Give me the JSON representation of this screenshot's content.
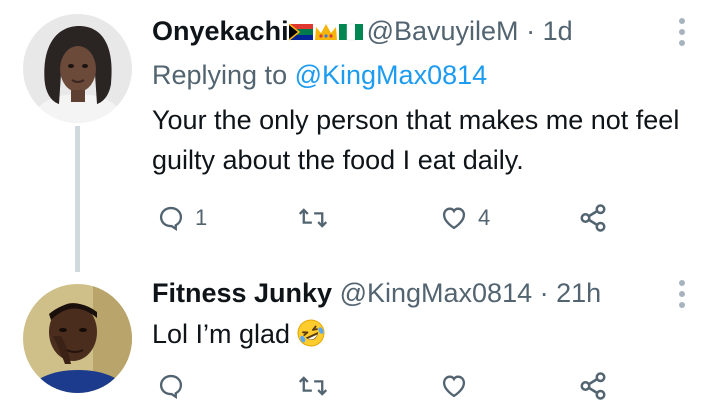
{
  "tweets": [
    {
      "name": "Onyekachi",
      "flags": [
        "south-africa-flag",
        "crown",
        "nigeria-flag"
      ],
      "handle": "@BavuyileM",
      "separator": "·",
      "time": "1d",
      "replying_label": "Replying to",
      "replying_to": "@KingMax0814",
      "text": "Your the only person that makes me not feel guilty about the food I eat daily.",
      "replies": "1",
      "retweets": "",
      "likes": "4"
    },
    {
      "name": "Fitness Junky",
      "handle": "@KingMax0814",
      "separator": "·",
      "time": "21h",
      "text": "Lol I’m glad",
      "emoji": "rolling-on-floor-laughing",
      "replies": "",
      "retweets": "",
      "likes": ""
    }
  ],
  "colors": {
    "text": "#0f1419",
    "secondary": "#536471",
    "link": "#1d9bf0",
    "thread_line": "#cfd9de"
  }
}
